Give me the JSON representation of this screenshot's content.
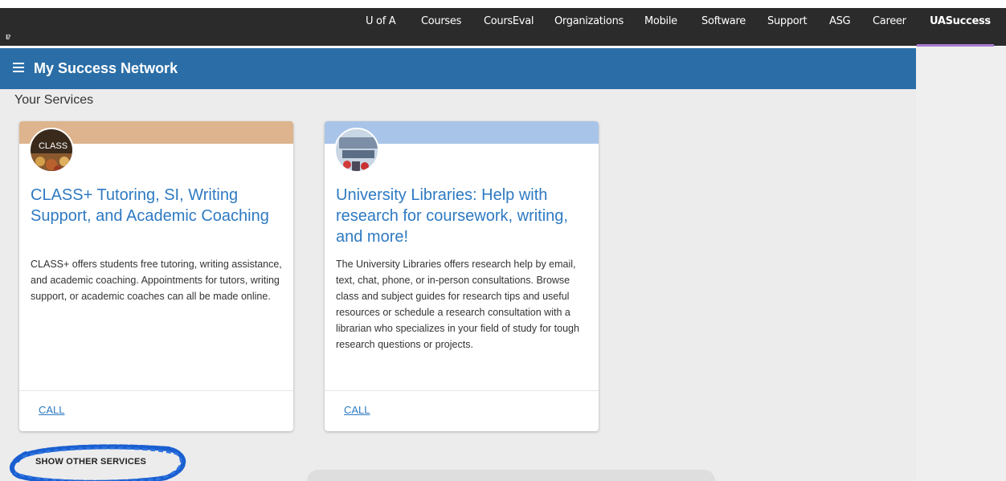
{
  "topnav": {
    "sso_glyph": "ɐ",
    "items": [
      {
        "label": "U of A"
      },
      {
        "label": "Courses"
      },
      {
        "label": "CoursEval"
      },
      {
        "label": "Organizations"
      },
      {
        "label": "Mobile"
      },
      {
        "label": "Software"
      },
      {
        "label": "Support"
      },
      {
        "label": "ASG"
      },
      {
        "label": "Career"
      },
      {
        "label": "UASuccess",
        "active": true
      }
    ]
  },
  "header": {
    "title": "My Success Network",
    "menu_icon": "hamburger-icon"
  },
  "main": {
    "section_title": "Your Services",
    "cards": [
      {
        "title": "CLASS+ Tutoring, SI, Writing Support, and Academic Coaching",
        "description": "CLASS+ offers students free tutoring, writing assistance, and academic coaching. Appointments for tutors, writing support, or academic coaches can all be made online.",
        "avatar_text": "CLASS",
        "band_color": "#ddb48d",
        "link": "CALL"
      },
      {
        "title": "University Libraries: Help with research for coursework, writing, and more!",
        "description": "The University Libraries offers research help by email, text, chat, phone, or in-person consultations. Browse class and subject guides for research tips and useful resources or schedule a research consultation with a librarian who specializes in your field of study for tough research questions or projects.",
        "avatar_text": "",
        "band_color": "#a8c4e8",
        "link": "CALL"
      }
    ],
    "show_others_label": "SHOW OTHER SERVICES"
  },
  "colors": {
    "topbar": "#2b2b2b",
    "appbar": "#2b6ea7",
    "link": "#2e7ac2",
    "annotation": "#1a5fd0"
  }
}
